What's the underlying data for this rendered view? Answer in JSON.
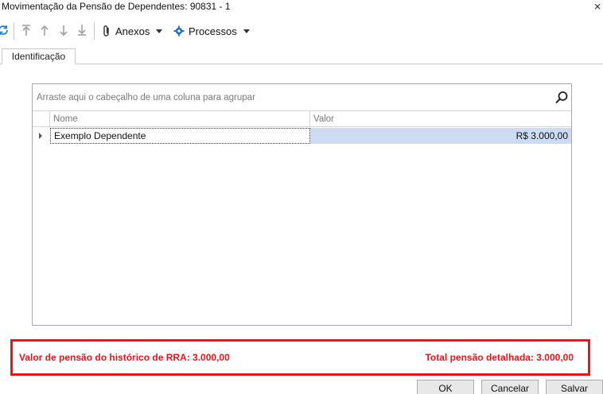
{
  "window": {
    "title": "Movimentação da Pensão de Dependentes: 90831 - 1",
    "close_glyph": "⨯"
  },
  "toolbar": {
    "refresh_icon": "refresh-icon",
    "nav_icons": [
      "move-first-icon",
      "move-up-icon",
      "move-down-icon",
      "move-last-icon"
    ],
    "anexos_label": "Anexos",
    "processos_label": "Processos"
  },
  "tabs": [
    {
      "label": "Identificação"
    }
  ],
  "grid": {
    "group_hint": "Arraste aqui o cabeçalho de uma coluna para agrupar",
    "columns": [
      "Nome",
      "Valor"
    ],
    "rows": [
      {
        "nome": "Exemplo Dependente",
        "valor": "R$ 3.000,00"
      }
    ]
  },
  "summary": {
    "left_text": "Valor de pensão do histórico de RRA: 3.000,00",
    "right_text": "Total pensão detalhada: 3.000,00",
    "highlight_color": "#e3161d"
  },
  "buttons": {
    "ok": "OK",
    "cancel": "Cancelar",
    "save": "Salvar"
  }
}
